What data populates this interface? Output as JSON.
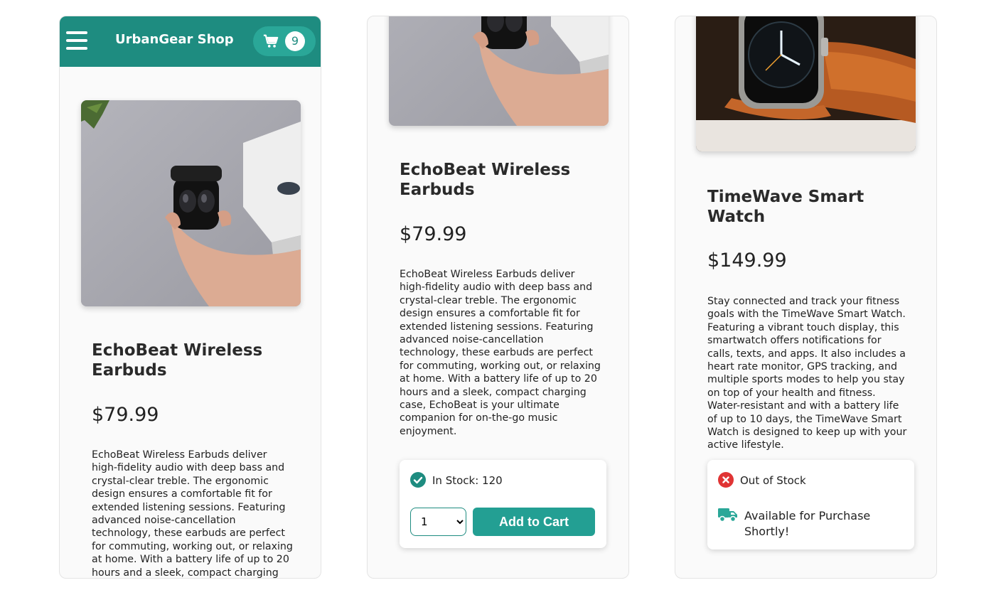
{
  "header": {
    "shop_title": "UrbanGear Shop",
    "cart_count": "9"
  },
  "colors": {
    "header_bg": "#1e8c80",
    "cart_pill": "#2aa798",
    "add_to_cart_bg": "#239f93",
    "in_stock_icon": "#1e8c80",
    "out_of_stock_icon": "#e03434",
    "truck_icon": "#2aa798"
  },
  "screens": [
    {
      "product": {
        "name": "EchoBeat Wireless Earbuds",
        "price": "$79.99",
        "description": "EchoBeat Wireless Earbuds deliver high-fidelity audio with deep bass and crystal-clear treble. The ergonomic design ensures a comfortable fit for extended listening sessions. Featuring advanced noise-cancellation technology, these earbuds are perfect for commuting, working out, or relaxing at home. With a battery life of up to 20 hours and a sleek, compact charging case, EchoBeat is your ultimate companion for on-the-go music enjoyment.",
        "image_icon": "earbuds-photo"
      }
    },
    {
      "product": {
        "name": "EchoBeat Wireless Earbuds",
        "price": "$79.99",
        "description": "EchoBeat Wireless Earbuds deliver high-fidelity audio with deep bass and crystal-clear treble. The ergonomic design ensures a comfortable fit for extended listening sessions. Featuring advanced noise-cancellation technology, these earbuds are perfect for commuting, working out, or relaxing at home. With a battery life of up to 20 hours and a sleek, compact charging case, EchoBeat is your ultimate companion for on-the-go music enjoyment.",
        "image_icon": "earbuds-photo"
      },
      "stock": {
        "status_icon": "check-circle-icon",
        "status_text": "In Stock: 120",
        "quantity_selected": "1",
        "add_to_cart_label": "Add to Cart"
      }
    },
    {
      "product": {
        "name": "TimeWave Smart Watch",
        "price": "$149.99",
        "description": "Stay connected and track your fitness goals with the TimeWave Smart Watch. Featuring a vibrant touch display, this smartwatch offers notifications for calls, texts, and apps. It also includes a heart rate monitor, GPS tracking, and multiple sports modes to help you stay on top of your health and fitness. Water-resistant and with a battery life of up to 10 days, the TimeWave Smart Watch is designed to keep up with your active lifestyle.",
        "image_icon": "smartwatch-photo"
      },
      "stock": {
        "status_icon": "x-circle-icon",
        "status_text": "Out of Stock",
        "availability_icon": "truck-icon",
        "availability_text": "Available for Purchase Shortly!"
      }
    }
  ]
}
